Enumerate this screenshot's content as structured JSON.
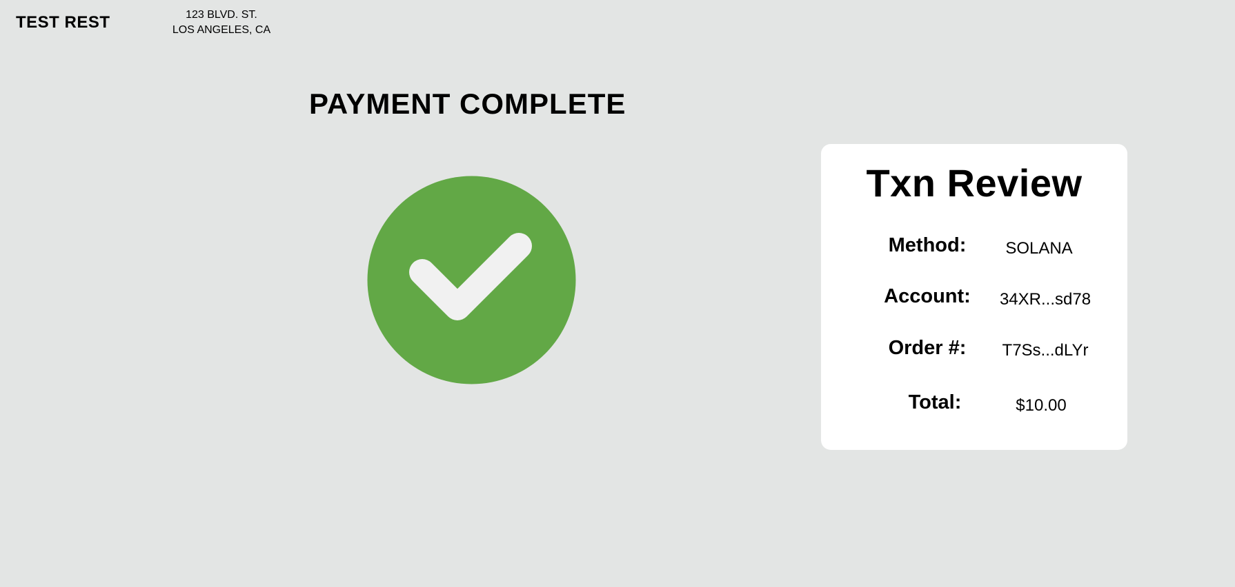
{
  "header": {
    "brand": "TEST REST",
    "address_line1": "123 BLVD. ST.",
    "address_line2": "LOS ANGELES, CA"
  },
  "status": {
    "title": "PAYMENT COMPLETE",
    "icon": "check-circle-icon",
    "icon_color": "#62a846"
  },
  "review": {
    "title": "Txn Review",
    "rows": [
      {
        "label": "Method:",
        "value": "SOLANA"
      },
      {
        "label": "Account:",
        "value": "34XR...sd78"
      },
      {
        "label": "Order #:",
        "value": "T7Ss...dLYr"
      },
      {
        "label": "Total:",
        "value": "$10.00"
      }
    ]
  },
  "colors": {
    "background": "#e3e5e4",
    "card": "#ffffff",
    "check_mark": "#f1f1f1"
  }
}
